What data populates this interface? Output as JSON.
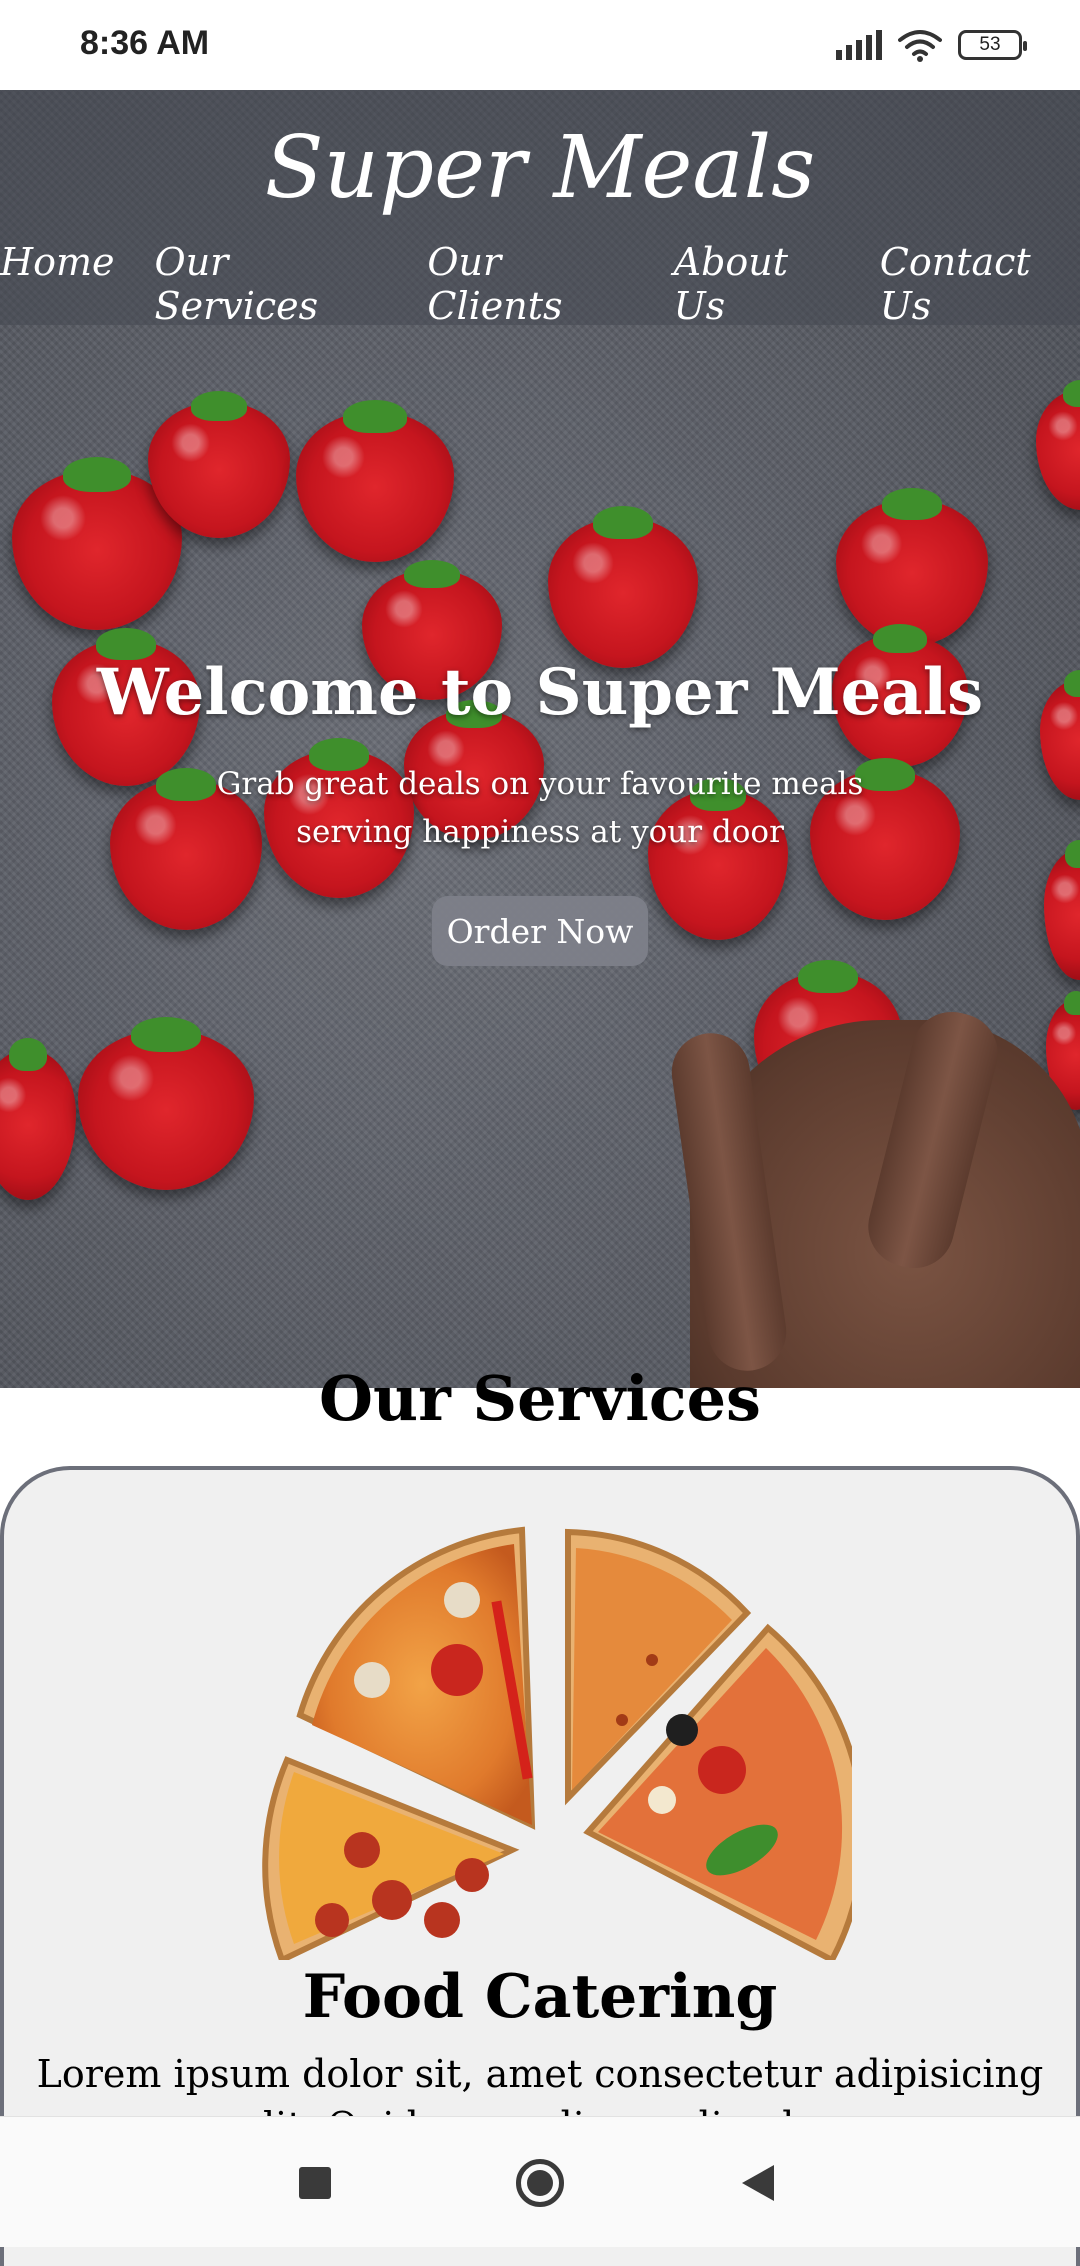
{
  "status_bar": {
    "time": "8:36 AM",
    "battery": "53"
  },
  "header": {
    "logo": "Super Meals",
    "nav": [
      "Home",
      "Our Services",
      "Our Clients",
      "About Us",
      "Contact Us"
    ]
  },
  "hero": {
    "title": "Welcome to Super Meals",
    "subtitle_line1": "Grab great deals on your favourite meals",
    "subtitle_line2": "serving happiness at your door",
    "cta_label": "Order Now"
  },
  "services": {
    "title": "Our Services",
    "card": {
      "title": "Food Catering",
      "text": "Lorem ipsum dolor sit, amet consectetur adipisicing elit. Quidem modi repudiandae"
    }
  },
  "colors": {
    "hero_bg": "#5d6068",
    "button_bg": "#7d8089",
    "card_border": "#6c6f7a",
    "card_bg": "#f0f0f0"
  },
  "icons": {
    "signal": "signal-icon",
    "wifi": "wifi-icon",
    "battery": "battery-icon",
    "recents": "square-icon",
    "home": "circle-icon",
    "back": "triangle-back-icon"
  }
}
